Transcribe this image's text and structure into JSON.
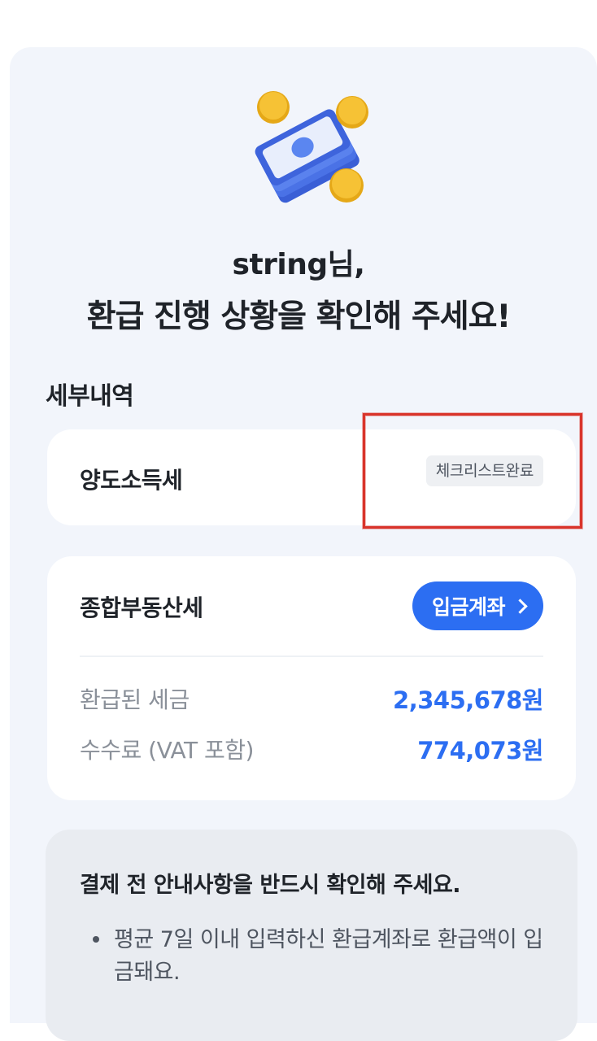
{
  "greeting": {
    "name_line": "string님,",
    "title": "환급 진행 상황을 확인해 주세요!"
  },
  "hero": {
    "icon": "money-coins-icon"
  },
  "section": {
    "label": "세부내역"
  },
  "cards": {
    "transfer_tax": {
      "title": "양도소득세",
      "badge": "체크리스트완료"
    },
    "property_tax": {
      "title": "종합부동산세",
      "account_button": "입금계좌",
      "rows": [
        {
          "label": "환급된 세금",
          "value": "2,345,678원"
        },
        {
          "label": "수수료 (VAT 포함)",
          "value": "774,073원"
        }
      ]
    }
  },
  "notice": {
    "title": "결제 전 안내사항을 반드시 확인해 주세요.",
    "items": [
      {
        "text": "평균 7일 이내 입력하신 환급계좌로 환급액이 입금돼요."
      }
    ]
  },
  "colors": {
    "accent": "#2c6ef2",
    "highlight": "#d9342b",
    "panel": "#f2f5fb"
  }
}
